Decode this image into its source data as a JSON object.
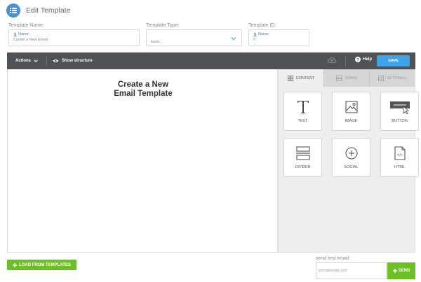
{
  "header": {
    "title": "Edit Template"
  },
  "fields": {
    "name": {
      "label": "Template Name:",
      "sub_label": "Name:",
      "value": "Create a New Email"
    },
    "type": {
      "label": "Template Type:",
      "value": "basic"
    },
    "id": {
      "label": "Template ID:",
      "sub_label": "Name:",
      "value": "0"
    }
  },
  "toolbar": {
    "actions_label": "Actions",
    "structure_label": "Show structure",
    "help_label": "Help",
    "save_label": "SAVE"
  },
  "canvas": {
    "line1": "Create a New",
    "line2": "Email Template"
  },
  "panel": {
    "tabs": [
      {
        "label": "CONTENT",
        "icon": "grid-icon"
      },
      {
        "label": "ROWS",
        "icon": "rows-icon"
      },
      {
        "label": "SETTINGS",
        "icon": "settings-icon"
      }
    ],
    "blocks": [
      {
        "label": "TEXT",
        "icon": "text-icon"
      },
      {
        "label": "IMAGE",
        "icon": "image-icon"
      },
      {
        "label": "BUTTON",
        "icon": "button-icon"
      },
      {
        "label": "DIVIDER",
        "icon": "divider-icon"
      },
      {
        "label": "SOCIAL",
        "icon": "social-icon"
      },
      {
        "label": "HTML",
        "icon": "html-icon"
      }
    ]
  },
  "footer": {
    "load_label": "LOAD FROM TEMPLATES",
    "test_label": "send test email:",
    "test_value": "john@email.com",
    "send_label": "SEND"
  },
  "colors": {
    "accent_blue": "#3ea4e8",
    "toolbar_bg": "#4d5356",
    "green": "#6cc024",
    "header_icon": "#4a90d9"
  }
}
